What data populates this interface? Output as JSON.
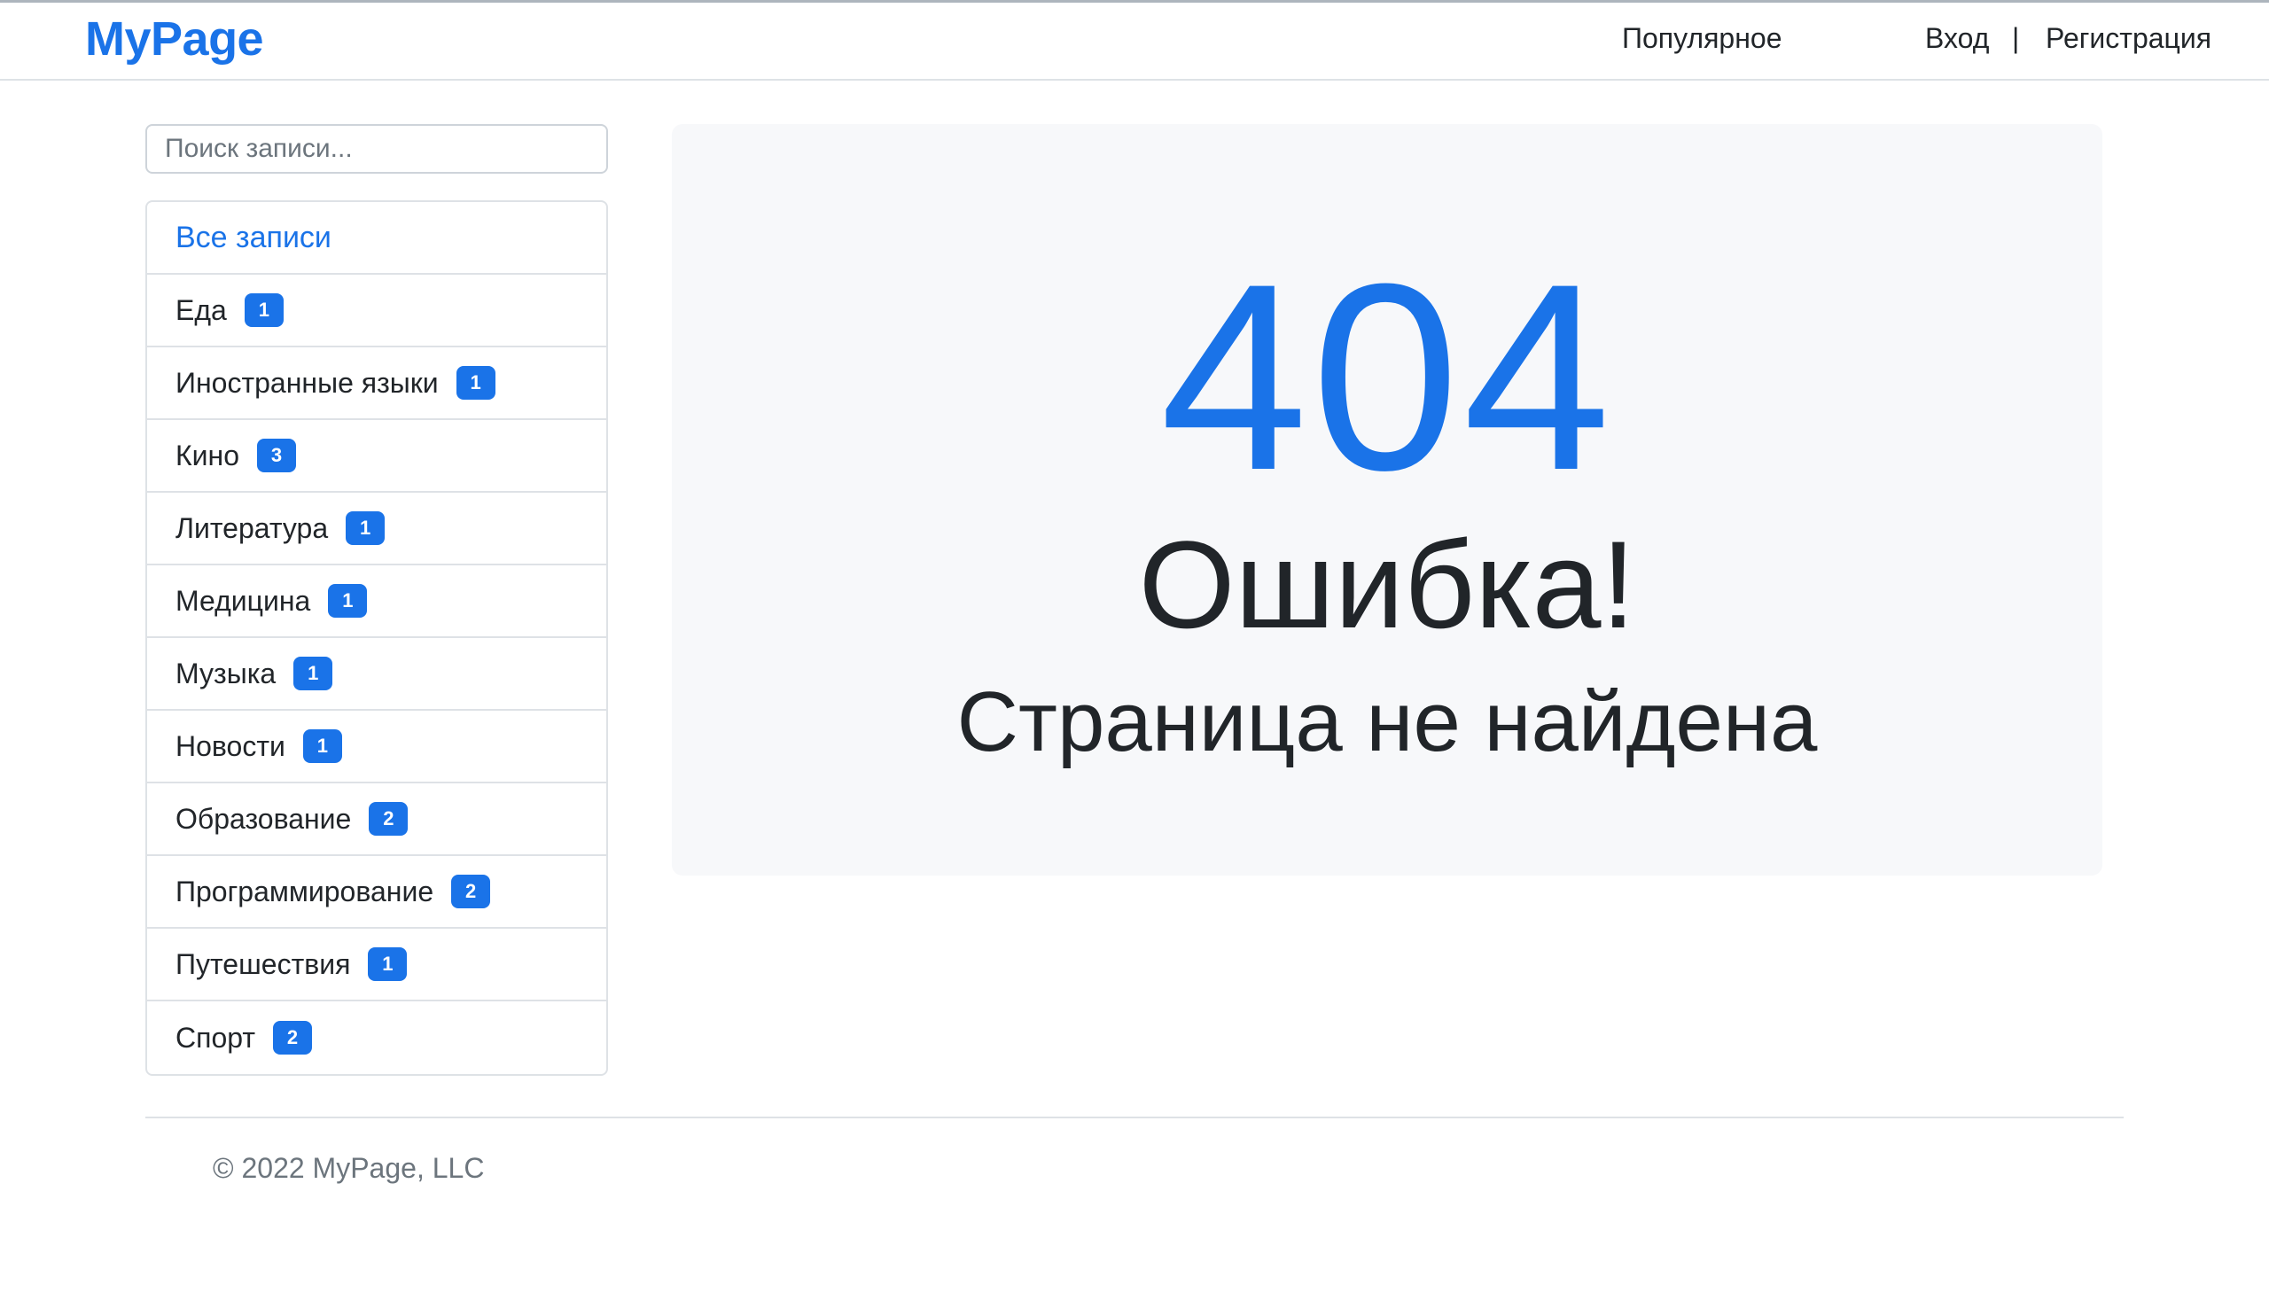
{
  "header": {
    "brand": "MyPage",
    "nav": {
      "popular": "Популярное",
      "login": "Вход",
      "separator": "|",
      "register": "Регистрация"
    }
  },
  "sidebar": {
    "search": {
      "placeholder": "Поиск записи...",
      "value": ""
    },
    "all_label": "Все записи",
    "categories": [
      {
        "label": "Еда",
        "count": "1"
      },
      {
        "label": "Иностранные языки",
        "count": "1"
      },
      {
        "label": "Кино",
        "count": "3"
      },
      {
        "label": "Литература",
        "count": "1"
      },
      {
        "label": "Медицина",
        "count": "1"
      },
      {
        "label": "Музыка",
        "count": "1"
      },
      {
        "label": "Новости",
        "count": "1"
      },
      {
        "label": "Образование",
        "count": "2"
      },
      {
        "label": "Программирование",
        "count": "2"
      },
      {
        "label": "Путешествия",
        "count": "1"
      },
      {
        "label": "Спорт",
        "count": "2"
      }
    ]
  },
  "main": {
    "code": "404",
    "title": "Ошибка!",
    "subtitle": "Страница не найдена"
  },
  "footer": {
    "copyright": "© 2022 MyPage, LLC"
  },
  "colors": {
    "accent": "#1a73e8",
    "panel_bg": "#f7f8fa",
    "text": "#212529",
    "muted": "#6c757d",
    "border": "#dee2e6"
  }
}
